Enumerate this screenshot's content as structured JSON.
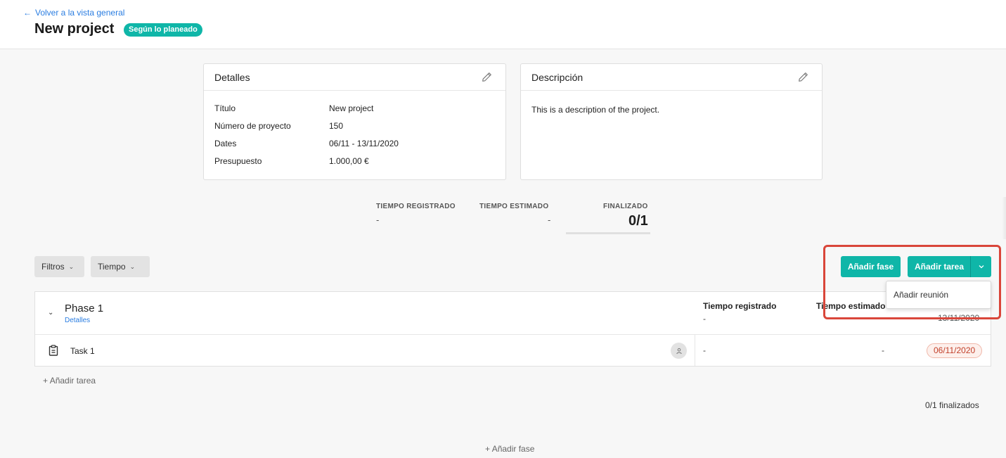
{
  "header": {
    "back_label": "Volver a la vista general",
    "title": "New project",
    "status": "Según lo planeado"
  },
  "details_card": {
    "title": "Detalles",
    "rows": [
      {
        "label": "Título",
        "value": "New project"
      },
      {
        "label": "Número de proyecto",
        "value": "150"
      },
      {
        "label": "Dates",
        "value": "06/11 - 13/11/2020"
      },
      {
        "label": "Presupuesto",
        "value": "1.000,00 €"
      }
    ]
  },
  "description_card": {
    "title": "Descripción",
    "text": "This is a description of the project."
  },
  "stats": {
    "registered_label": "TIEMPO REGISTRADO",
    "registered_value": "-",
    "estimated_label": "TIEMPO ESTIMADO",
    "estimated_value": "-",
    "finished_label": "FINALIZADO",
    "finished_value": "0/1",
    "finished_progress": 0
  },
  "filters": {
    "filters_label": "Filtros",
    "time_label": "Tiempo"
  },
  "actions": {
    "add_phase": "Añadir fase",
    "add_task": "Añadir tarea",
    "menu_item": "Añadir reunión"
  },
  "phase": {
    "name": "Phase 1",
    "details_link": "Detalles",
    "col_registered": "Tiempo registrado",
    "col_estimated": "Tiempo estimado",
    "registered_value": "-",
    "date": "13/11/2020",
    "task": {
      "name": "Task 1",
      "registered": "-",
      "estimated": "-",
      "due": "06/11/2020"
    }
  },
  "footer": {
    "add_task": "Añadir tarea",
    "finished": "0/1 finalizados",
    "add_phase": "Añadir fase"
  },
  "colors": {
    "accent": "#0fb6a8",
    "link": "#2a7de1",
    "highlight": "#d9463a",
    "overdue": "#c2402a"
  }
}
